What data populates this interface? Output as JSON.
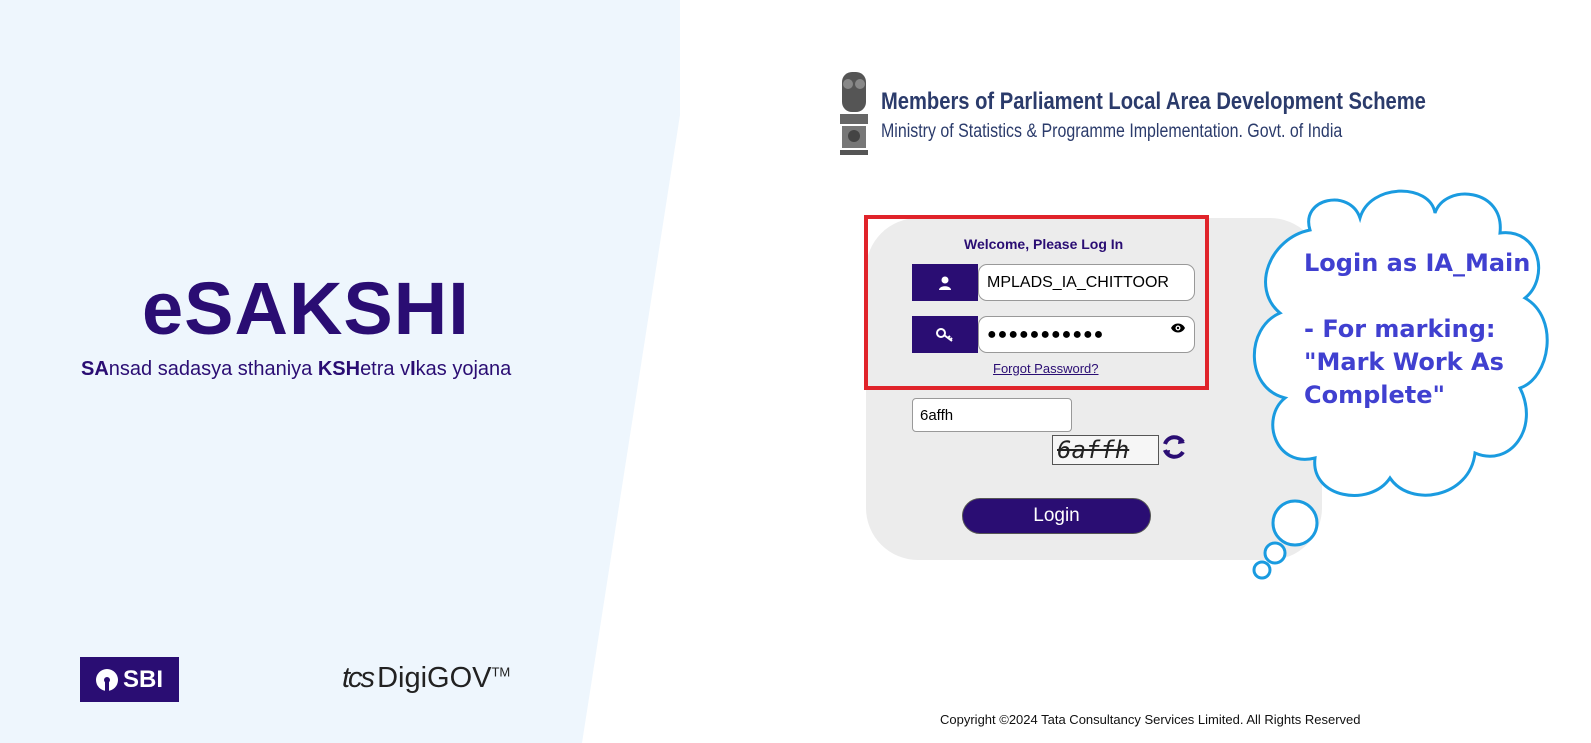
{
  "brand": {
    "title": "eSAKSHI",
    "subtitle_parts": [
      "SA",
      "nsad sadasya sthaniya ",
      "KSH",
      "etra v",
      "I",
      "kas yojana"
    ]
  },
  "partners": {
    "sbi": "SBI",
    "tcs": "tcs",
    "digigov": "DigiGOV",
    "tm": "TM"
  },
  "header": {
    "scheme": "Members of Parliament Local Area Development Scheme",
    "ministry": "Ministry of Statistics & Programme Implementation. Govt. of India"
  },
  "login": {
    "welcome": "Welcome, Please Log In",
    "username": "MPLADS_IA_CHITTOOR",
    "password_mask": "●●●●●●●●●●●",
    "forgot": "Forgot Password?",
    "captcha_value": "6affh",
    "captcha_image_text": "6affh",
    "button": "Login"
  },
  "annotation": {
    "text": "Login as IA_Main\n\n- For marking:\n\"Mark Work As\nComplete\"",
    "highlight_color": "#e0232a",
    "cloud_color": "#1a9be0"
  },
  "footer": {
    "copyright": "Copyright ©2024 Tata Consultancy Services Limited. All Rights Reserved"
  },
  "icons": [
    "user-icon",
    "key-icon",
    "eye-icon",
    "refresh-icon",
    "national-emblem-icon"
  ]
}
